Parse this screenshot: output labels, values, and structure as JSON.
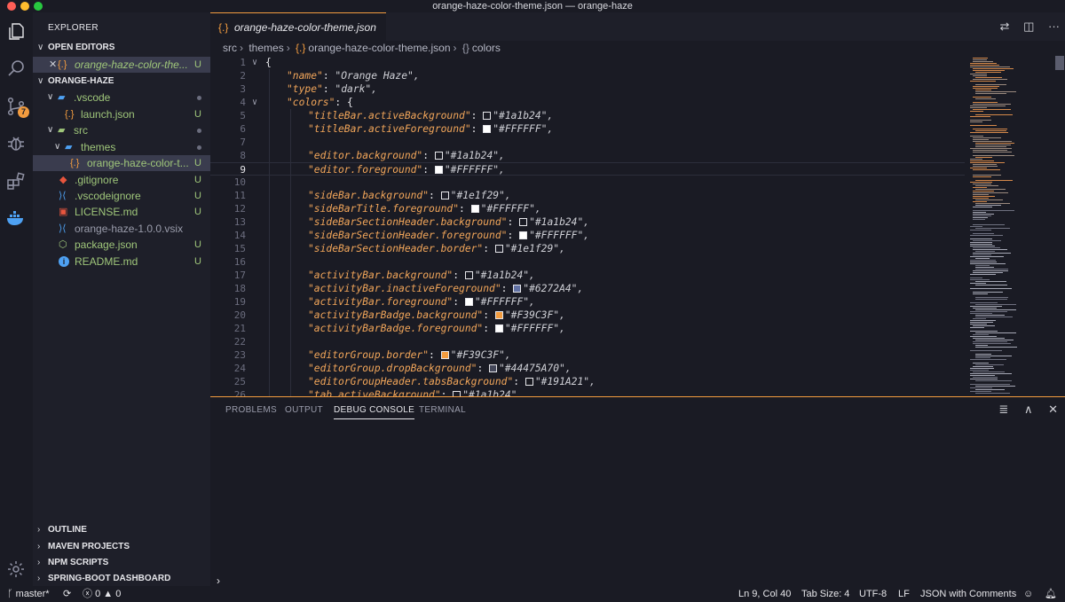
{
  "window": {
    "title": "orange-haze-color-theme.json — orange-haze"
  },
  "activity_bar": {
    "scm_badge": "7"
  },
  "sidebar": {
    "title": "EXPLORER",
    "open_editors": {
      "label": "OPEN EDITORS",
      "file": "orange-haze-color-the...",
      "status": "U"
    },
    "project": {
      "label": "ORANGE-HAZE"
    },
    "tree": [
      {
        "label": ".vscode",
        "status": ""
      },
      {
        "label": "launch.json",
        "status": "U"
      },
      {
        "label": "src",
        "status": ""
      },
      {
        "label": "themes",
        "status": ""
      },
      {
        "label": "orange-haze-color-t...",
        "status": "U"
      },
      {
        "label": ".gitignore",
        "status": "U"
      },
      {
        "label": ".vscodeignore",
        "status": "U"
      },
      {
        "label": "LICENSE.md",
        "status": "U"
      },
      {
        "label": "orange-haze-1.0.0.vsix",
        "status": ""
      },
      {
        "label": "package.json",
        "status": "U"
      },
      {
        "label": "README.md",
        "status": "U"
      }
    ],
    "bottom_sections": [
      "OUTLINE",
      "MAVEN PROJECTS",
      "NPM SCRIPTS",
      "SPRING-BOOT DASHBOARD"
    ]
  },
  "editor": {
    "tab_label": "orange-haze-color-theme.json",
    "breadcrumb": [
      "src",
      "themes",
      "orange-haze-color-theme.json",
      "colors"
    ],
    "lines": [
      {
        "n": "1",
        "indent": 0,
        "text": "{"
      },
      {
        "n": "2",
        "indent": 1,
        "key": "\"name\"",
        "value": "\"Orange Haze\","
      },
      {
        "n": "3",
        "indent": 1,
        "key": "\"type\"",
        "value": "\"dark\","
      },
      {
        "n": "4",
        "indent": 1,
        "key": "\"colors\"",
        "value": "{"
      },
      {
        "n": "5",
        "indent": 2,
        "key": "\"titleBar.activeBackground\"",
        "swatch": "#1a1b24",
        "value": "\"#1a1b24\","
      },
      {
        "n": "6",
        "indent": 2,
        "key": "\"titleBar.activeForeground\"",
        "swatch": "#FFFFFF",
        "value": "\"#FFFFFF\","
      },
      {
        "n": "7",
        "indent": 2
      },
      {
        "n": "8",
        "indent": 2,
        "key": "\"editor.background\"",
        "swatch": "#1a1b24",
        "value": "\"#1a1b24\","
      },
      {
        "n": "9",
        "indent": 2,
        "key": "\"editor.foreground\"",
        "swatch": "#FFFFFF",
        "value": "\"#FFFFFF\","
      },
      {
        "n": "10",
        "indent": 2
      },
      {
        "n": "11",
        "indent": 2,
        "key": "\"sideBar.background\"",
        "swatch": "#1e1f29",
        "value": "\"#1e1f29\","
      },
      {
        "n": "12",
        "indent": 2,
        "key": "\"sideBarTitle.foreground\"",
        "swatch": "#FFFFFF",
        "value": "\"#FFFFFF\","
      },
      {
        "n": "13",
        "indent": 2,
        "key": "\"sideBarSectionHeader.background\"",
        "swatch": "#1a1b24",
        "value": "\"#1a1b24\","
      },
      {
        "n": "14",
        "indent": 2,
        "key": "\"sideBarSectionHeader.foreground\"",
        "swatch": "#FFFFFF",
        "value": "\"#FFFFFF\","
      },
      {
        "n": "15",
        "indent": 2,
        "key": "\"sideBarSectionHeader.border\"",
        "swatch": "#1e1f29",
        "value": "\"#1e1f29\","
      },
      {
        "n": "16",
        "indent": 2
      },
      {
        "n": "17",
        "indent": 2,
        "key": "\"activityBar.background\"",
        "swatch": "#1a1b24",
        "value": "\"#1a1b24\","
      },
      {
        "n": "18",
        "indent": 2,
        "key": "\"activityBar.inactiveForeground\"",
        "swatch": "#6272A4",
        "value": "\"#6272A4\","
      },
      {
        "n": "19",
        "indent": 2,
        "key": "\"activityBar.foreground\"",
        "swatch": "#FFFFFF",
        "value": "\"#FFFFFF\","
      },
      {
        "n": "20",
        "indent": 2,
        "key": "\"activityBarBadge.background\"",
        "swatch": "#F39C3F",
        "value": "\"#F39C3F\","
      },
      {
        "n": "21",
        "indent": 2,
        "key": "\"activityBarBadge.foreground\"",
        "swatch": "#FFFFFF",
        "value": "\"#FFFFFF\","
      },
      {
        "n": "22",
        "indent": 2
      },
      {
        "n": "23",
        "indent": 2,
        "key": "\"editorGroup.border\"",
        "swatch": "#F39C3F",
        "value": "\"#F39C3F\","
      },
      {
        "n": "24",
        "indent": 2,
        "key": "\"editorGroup.dropBackground\"",
        "swatch": "#44475A",
        "value": "\"#44475A70\","
      },
      {
        "n": "25",
        "indent": 2,
        "key": "\"editorGroupHeader.tabsBackground\"",
        "swatch": "#191A21",
        "value": "\"#191A21\","
      },
      {
        "n": "26",
        "indent": 2,
        "key": "\"tab.activeBackground\"",
        "swatch": "#1a1b24",
        "value": "\"#1a1b24\","
      }
    ],
    "active_line": "9"
  },
  "panel": {
    "tabs": [
      "PROBLEMS",
      "OUTPUT",
      "DEBUG CONSOLE",
      "TERMINAL"
    ],
    "active_tab": "DEBUG CONSOLE",
    "prompt": "›"
  },
  "status_bar": {
    "branch": "master*",
    "errors": "0",
    "warnings": "0",
    "position": "Ln 9, Col 40",
    "tab_size": "Tab Size: 4",
    "encoding": "UTF-8",
    "eol": "LF",
    "language": "JSON with Comments"
  },
  "colors": {
    "accent": "#F39C3F",
    "background": "#1a1b24",
    "sidebar": "#1e1f29"
  }
}
